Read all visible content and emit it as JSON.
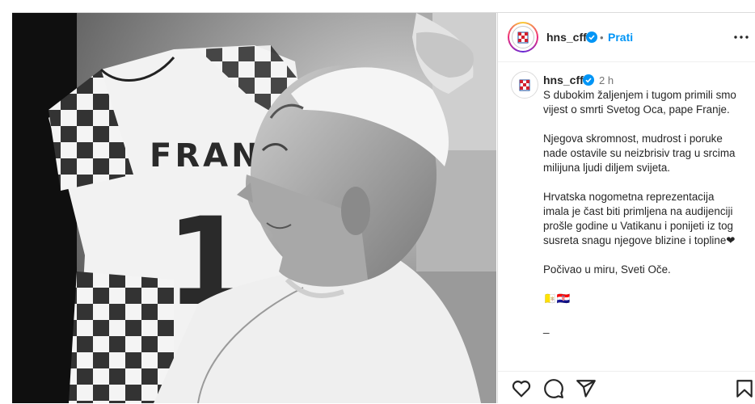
{
  "header": {
    "username": "hns_cff",
    "separator": "•",
    "follow_label": "Prati"
  },
  "caption": {
    "username": "hns_cff",
    "time": "2 h",
    "paragraphs": [
      "S dubokim žaljenjem i tugom primili smo vijest o smrti Svetog Oca, pape Franje.",
      "Njegova skromnost, mudrost i poruke nade ostavile su neizbrisiv trag u srcima milijuna ljudi diljem svijeta.",
      "Hrvatska nogometna reprezentacija imala je čast biti primljena na audijenciji prošle godine u Vatikanu i ponijeti iz tog susreta snagu njegove blizine i topline❤",
      "Počivao u miru, Sveti Oče.",
      "󠁧󠁢󠁥󠁮󠁧󠁿🇻🇦🇭🇷",
      "_"
    ]
  },
  "media": {
    "jersey_name": "FRANJO",
    "jersey_number": "1"
  },
  "colors": {
    "accent": "#0095f6",
    "verified": "#0095f6",
    "text": "#262626",
    "muted": "#737373"
  },
  "icons": [
    "verified-badge-icon",
    "more-options-icon",
    "heart-icon",
    "comment-icon",
    "share-icon",
    "save-bookmark-icon"
  ]
}
